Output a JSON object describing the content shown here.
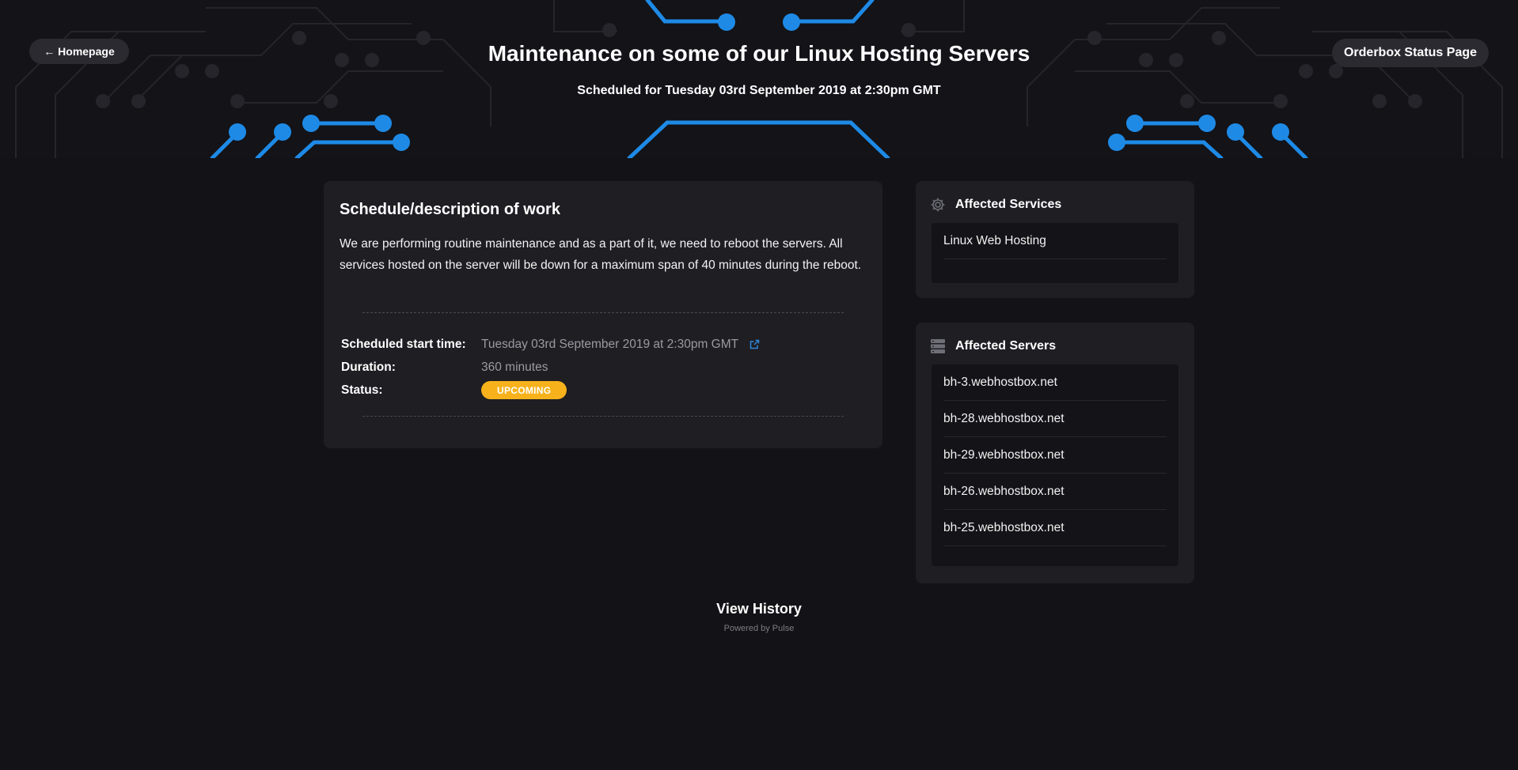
{
  "header": {
    "back_label": "← Homepage",
    "title": "Maintenance on some of our Linux Hosting Servers",
    "subtitle": "Scheduled for Tuesday 03rd September 2019 at 2:30pm GMT",
    "status_page_label": "Orderbox Status Page"
  },
  "main": {
    "heading": "Schedule/description of work",
    "description": "We are performing routine maintenance and as a part of it, we need to reboot the servers. All services hosted on the server will be down for a maximum span of 40 minutes during the reboot.",
    "details": {
      "start_label": "Scheduled start time:",
      "start_value": "Tuesday 03rd September 2019 at 2:30pm GMT",
      "duration_label": "Duration:",
      "duration_value": "360 minutes",
      "status_label": "Status:",
      "status_value": "UPCOMING"
    }
  },
  "affected_services": {
    "heading": "Affected Services",
    "icon": "gear-icon",
    "items": [
      "Linux Web Hosting"
    ]
  },
  "affected_servers": {
    "heading": "Affected Servers",
    "icon": "server-icon",
    "items": [
      "bh-3.webhostbox.net",
      "bh-28.webhostbox.net",
      "bh-29.webhostbox.net",
      "bh-26.webhostbox.net",
      "bh-25.webhostbox.net"
    ]
  },
  "footer": {
    "view_history": "View History",
    "powered_by": "Powered by Pulse"
  },
  "colors": {
    "background": "#131317",
    "card": "#1e1e23",
    "accent_blue": "#1e8ae6",
    "badge_upcoming": "#f7b21b"
  }
}
